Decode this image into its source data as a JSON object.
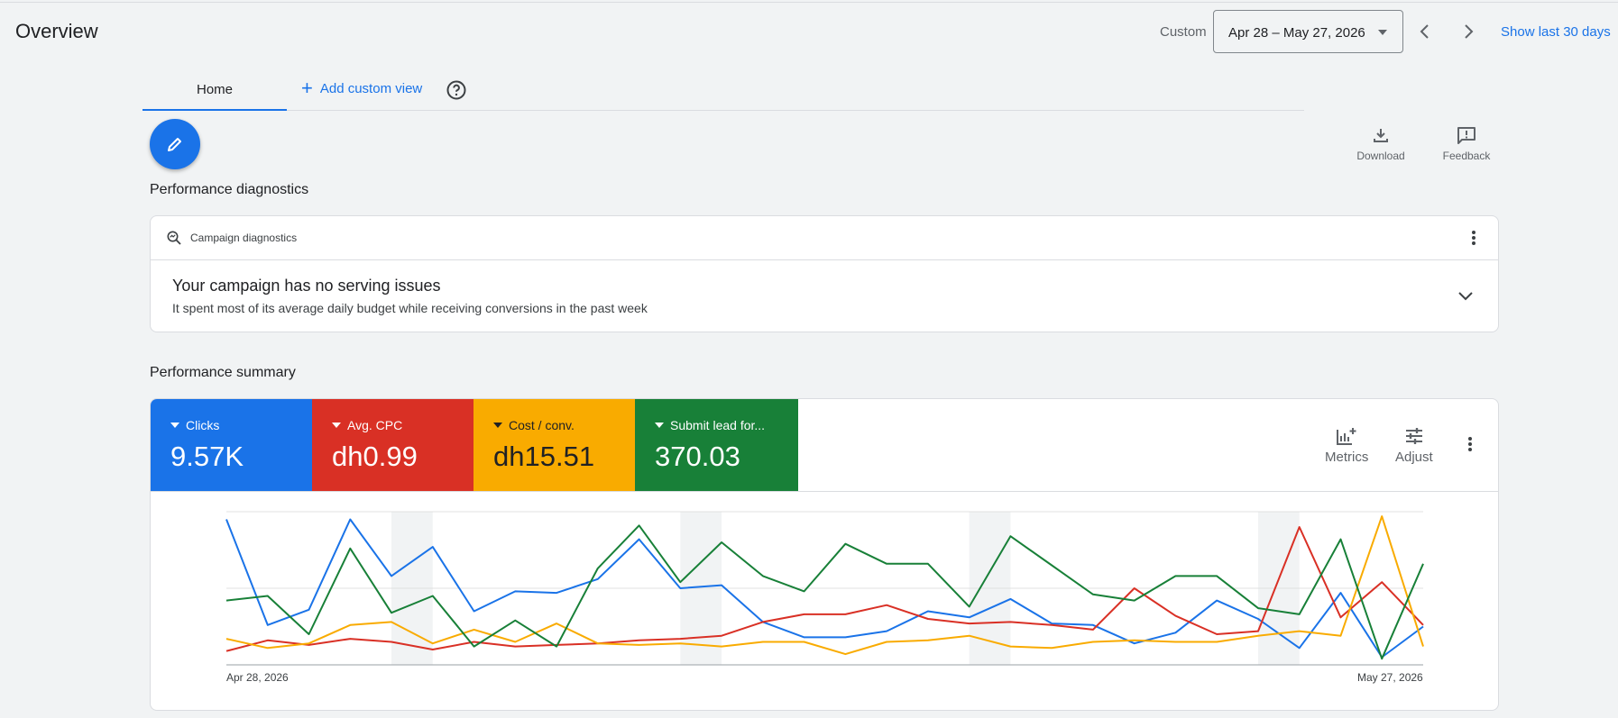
{
  "header": {
    "title": "Overview",
    "custom_label": "Custom",
    "date_range": "Apr 28 – May 27, 2026",
    "show_last": "Show last 30 days"
  },
  "tabs": {
    "home": "Home",
    "add_custom_view": "Add custom view"
  },
  "toolbar": {
    "download": "Download",
    "feedback": "Feedback"
  },
  "diagnostics": {
    "section_title": "Performance diagnostics",
    "card_label": "Campaign diagnostics",
    "headline": "Your campaign has no serving issues",
    "detail": "It spent most of its average daily budget while receiving conversions in the past week"
  },
  "summary": {
    "section_title": "Performance summary",
    "metrics": [
      {
        "label": "Clicks",
        "value": "9.57K",
        "color": "#1a73e8"
      },
      {
        "label": "Avg. CPC",
        "value": "dh0.99",
        "color": "#d93025"
      },
      {
        "label": "Cost / conv.",
        "value": "dh15.51",
        "color": "#f9ab00"
      },
      {
        "label": "Submit lead for...",
        "value": "370.03",
        "color": "#188038"
      }
    ],
    "metrics_button": "Metrics",
    "adjust_button": "Adjust"
  },
  "chart_data": {
    "type": "line",
    "x_start_label": "Apr 28, 2026",
    "x_end_label": "May 27, 2026",
    "normalized_scale": [
      0,
      100
    ],
    "weekend_shading": true,
    "grid": true,
    "series": [
      {
        "name": "Clicks",
        "color": "#1a73e8",
        "values": [
          95,
          26,
          36,
          95,
          58,
          77,
          35,
          48,
          47,
          56,
          82,
          50,
          52,
          28,
          18,
          18,
          22,
          35,
          31,
          43,
          27,
          26,
          14,
          21,
          42,
          30,
          11,
          47,
          5,
          25
        ]
      },
      {
        "name": "Avg. CPC",
        "color": "#d93025",
        "values": [
          9,
          16,
          13,
          17,
          15,
          10,
          15,
          12,
          13,
          14,
          16,
          17,
          19,
          28,
          33,
          33,
          39,
          30,
          27,
          28,
          26,
          23,
          50,
          32,
          20,
          22,
          90,
          31,
          54,
          26
        ]
      },
      {
        "name": "Cost / conv.",
        "color": "#f9ab00",
        "values": [
          17,
          11,
          14,
          26,
          28,
          14,
          23,
          15,
          27,
          14,
          13,
          14,
          12,
          15,
          15,
          7,
          15,
          16,
          19,
          12,
          11,
          15,
          16,
          15,
          15,
          19,
          22,
          19,
          97,
          12
        ]
      },
      {
        "name": "Submit lead for...",
        "color": "#188038",
        "values": [
          42,
          45,
          20,
          76,
          34,
          45,
          12,
          29,
          12,
          63,
          91,
          54,
          80,
          58,
          48,
          79,
          66,
          66,
          38,
          84,
          65,
          46,
          42,
          58,
          58,
          37,
          33,
          82,
          4,
          66
        ]
      }
    ]
  }
}
